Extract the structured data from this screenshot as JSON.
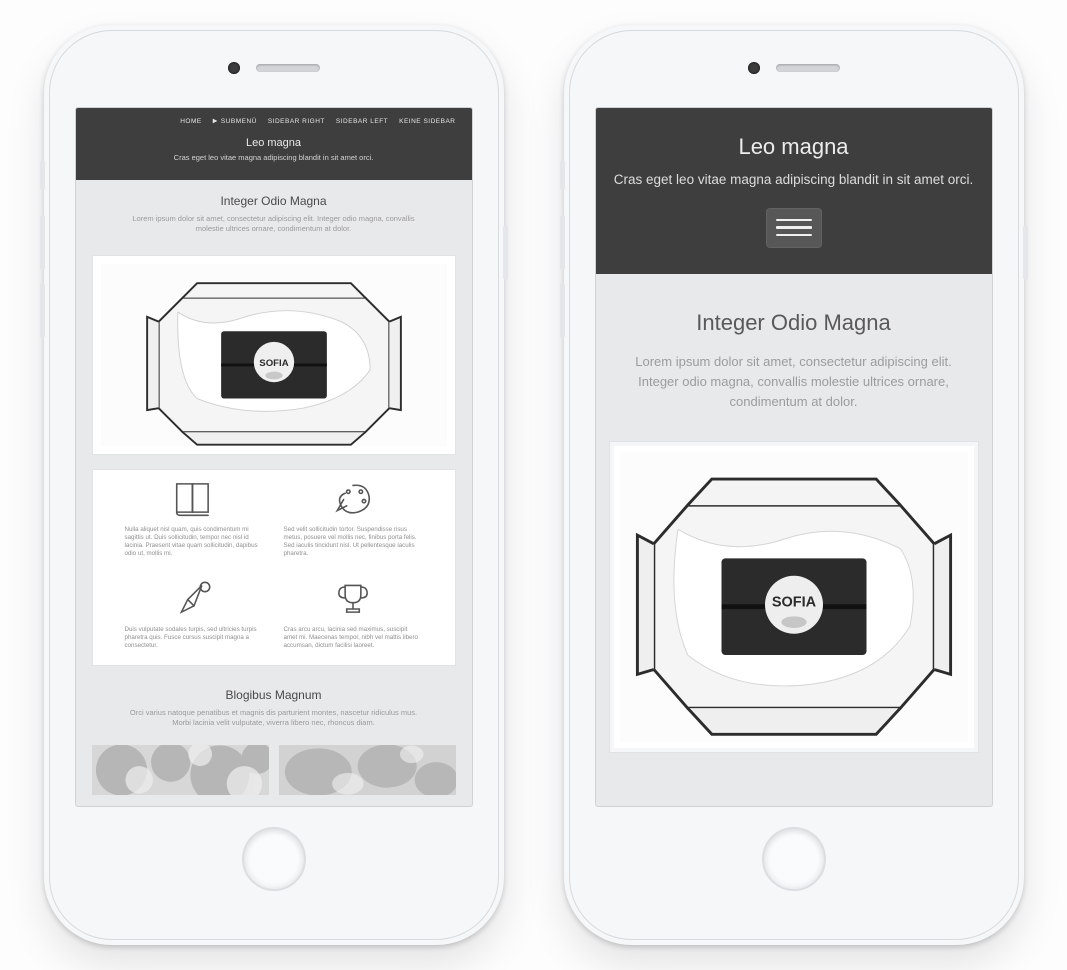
{
  "site": {
    "title": "Leo magna",
    "subtitle": "Cras eget leo vitae magna adipiscing blandit in sit amet orci."
  },
  "nav": {
    "items": [
      {
        "label": "HOME",
        "has_submenu": false
      },
      {
        "label": "SUBMENÜ",
        "has_submenu": true
      },
      {
        "label": "SIDEBAR RIGHT",
        "has_submenu": false
      },
      {
        "label": "SIDEBAR LEFT",
        "has_submenu": false
      },
      {
        "label": "KEINE SIDEBAR",
        "has_submenu": false
      }
    ]
  },
  "intro": {
    "heading": "Integer Odio Magna",
    "lead": "Lorem ipsum dolor sit amet, consectetur adipiscing elit. Integer odio magna, convallis molestie ultrices ornare, condimentum at dolor."
  },
  "product_box": {
    "brand": "SOFIA"
  },
  "features": [
    {
      "icon": "book-icon",
      "text": "Nulla aliquet nisl quam, quis condimentum mi sagittis ut. Duis sollicitudin, tempor nec nisl id lacinia. Praesent vitae quam sollicitudin, dapibus odio ut, mollis mi."
    },
    {
      "icon": "art-icon",
      "text": "Sed velit sollicitudin tortor. Suspendisse risus metus, posuere vel mollis nec, finibus porta felis. Sed iaculis tincidunt nisl. Ut pellentesque iaculis pharetra."
    },
    {
      "icon": "pen-icon",
      "text": "Duis vulputate sodales turpis, sed ultricies turpis pharetra quis. Fusce cursus suscipit magna a consectetur."
    },
    {
      "icon": "trophy-icon",
      "text": "Cras arcu arcu, lacinia sed maximus, suscipit amet mi. Maecenas tempor, nibh vel mattis libero accumsan, dictum facilisi laoreet."
    }
  ],
  "blog": {
    "heading": "Blogibus Magnum",
    "lead": "Orci varius natoque penatibus et magnis dis parturient montes, nascetur ridiculus mus. Morbi lacinia velit vulputate, viverra libero nec, rhoncus diam."
  }
}
